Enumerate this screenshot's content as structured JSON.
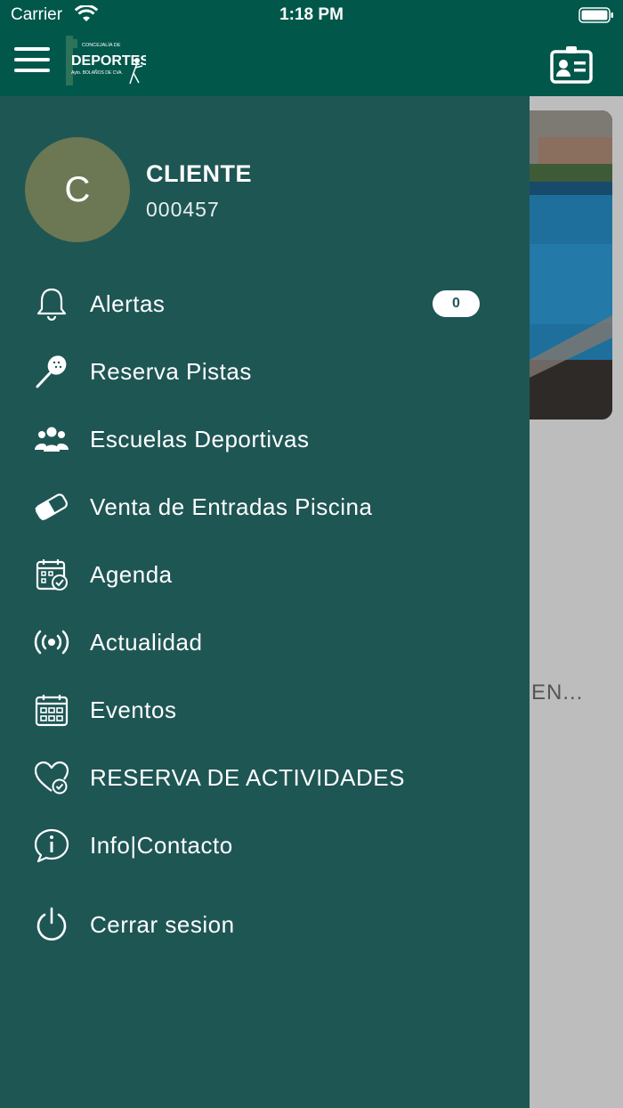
{
  "status_bar": {
    "carrier": "Carrier",
    "time": "1:18 PM"
  },
  "header": {
    "logo_text": {
      "top": "CONCEJALÍA DE",
      "main": "DEPORTES",
      "bottom": "Ayto. BOLAÑOS DE CVA."
    },
    "menu_icon": "hamburger-icon",
    "id_card_icon": "id-card-icon"
  },
  "profile": {
    "initial": "C",
    "name": "CLIENTE",
    "id": "000457"
  },
  "menu": [
    {
      "label": "Alertas",
      "icon": "bell-icon",
      "badge": "0"
    },
    {
      "label": "Reserva Pistas",
      "icon": "padel-racket-icon"
    },
    {
      "label": "Escuelas Deportivas",
      "icon": "group-icon"
    },
    {
      "label": "Venta de Entradas Piscina",
      "icon": "ticket-icon"
    },
    {
      "label": "Agenda",
      "icon": "calendar-check-icon"
    },
    {
      "label": "Actualidad",
      "icon": "broadcast-icon"
    },
    {
      "label": "Eventos",
      "icon": "calendar-grid-icon"
    },
    {
      "label": "RESERVA DE ACTIVIDADES",
      "icon": "heart-check-icon"
    },
    {
      "label": "Info|Contacto",
      "icon": "info-chat-icon"
    },
    {
      "label": "Cerrar sesion",
      "icon": "power-icon"
    }
  ],
  "background_content": {
    "text": "EN..."
  },
  "colors": {
    "header": "#02574b",
    "drawer": "#1e5654",
    "avatar": "#6b7853",
    "background": "#bdbdbd"
  }
}
